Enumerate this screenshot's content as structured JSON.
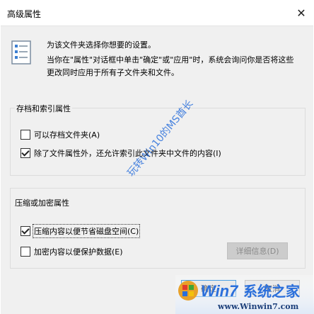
{
  "window": {
    "title": "高级属性",
    "close_icon": "close-icon"
  },
  "intro": {
    "line1": "为该文件夹选择你想要的设置。",
    "line2": "当你在\"属性\"对话框中单击\"确定\"或\"应用\"时，系统会询问你是否将这些更改同时应用于所有子文件夹和文件。"
  },
  "archive_group": {
    "title": "存档和索引属性",
    "options": [
      {
        "label": "可以存档文件夹(A)",
        "checked": false
      },
      {
        "label": "除了文件属性外，还允许索引此文件夹中文件的内容(I)",
        "checked": true
      }
    ]
  },
  "compress_group": {
    "title": "压缩或加密属性",
    "options": [
      {
        "label": "压缩内容以便节省磁盘空间(C)",
        "checked": true
      },
      {
        "label": "加密内容以便保护数据(E)",
        "checked": false
      }
    ],
    "details_label": "详细信息(D)"
  },
  "buttons": {
    "ok_label": "确定",
    "cancel_label": "取消"
  },
  "watermark": {
    "text": "玩转Win10的MS酋长"
  },
  "logo": {
    "brand_text": "系统之家",
    "url_text": "www.Winwin7.com",
    "win_text": "Win7",
    "accent": "#2a6fdb"
  }
}
